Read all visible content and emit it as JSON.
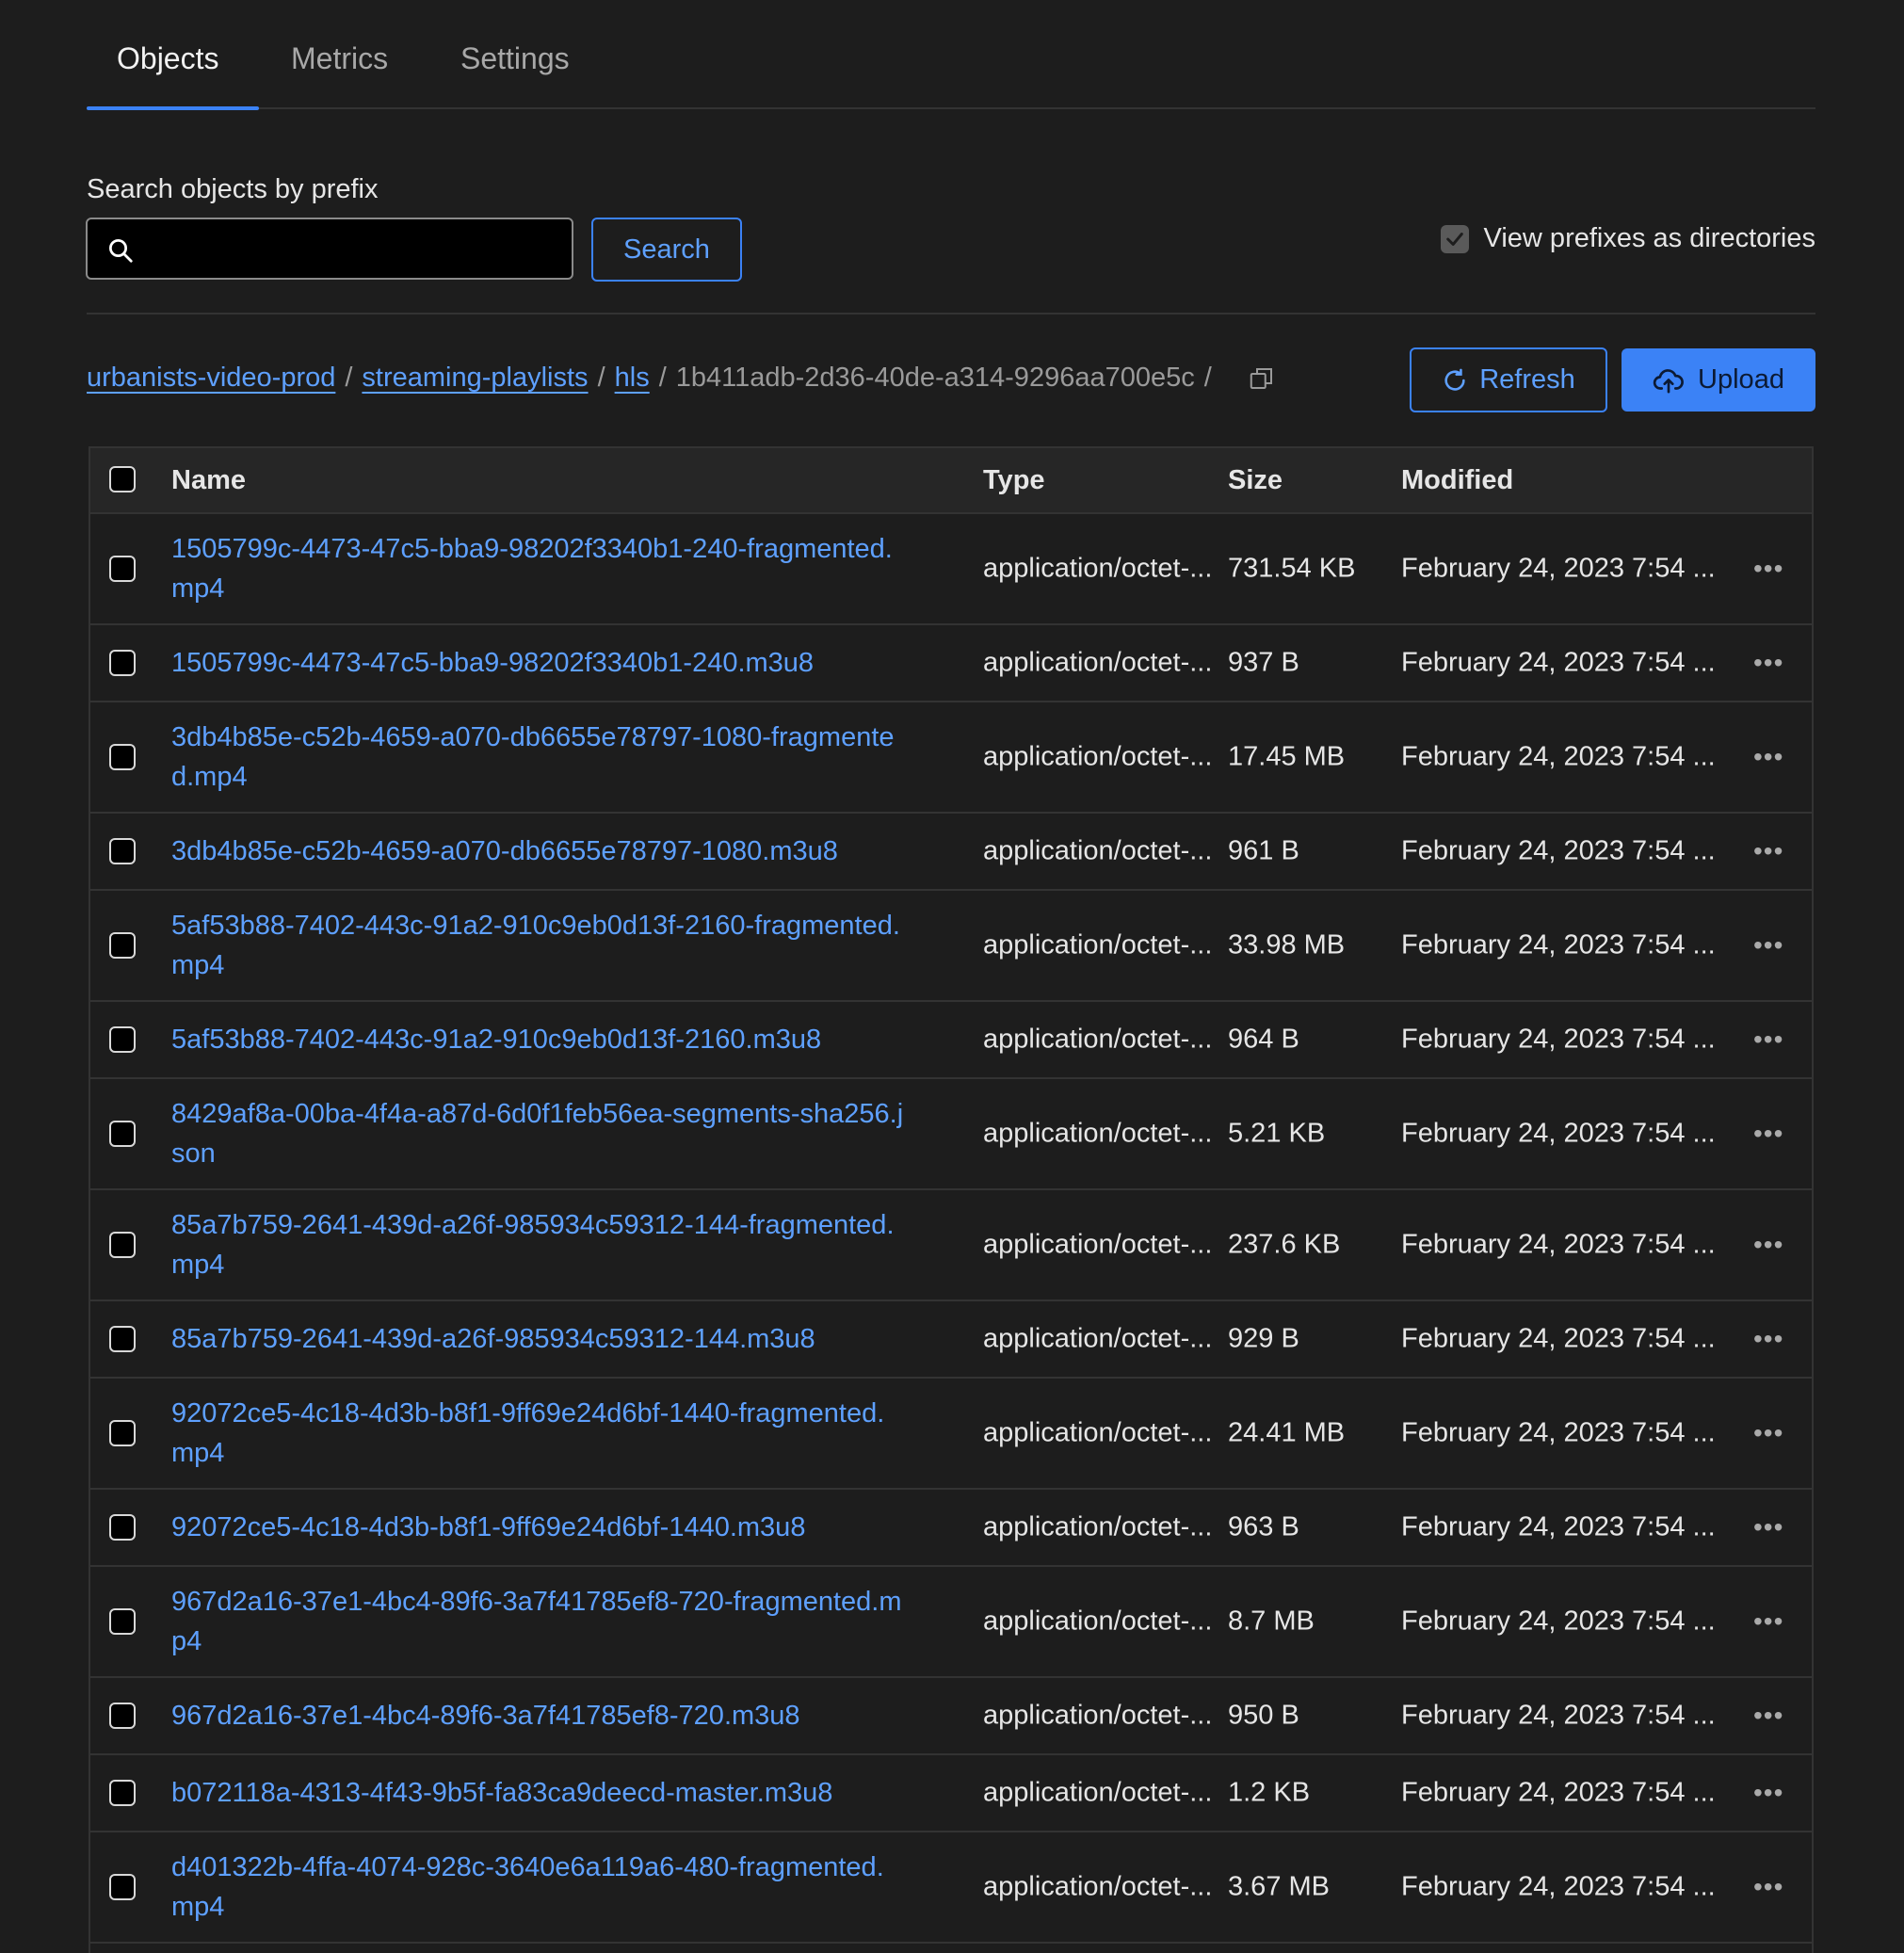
{
  "tabs": [
    {
      "label": "Objects"
    },
    {
      "label": "Metrics"
    },
    {
      "label": "Settings"
    }
  ],
  "search": {
    "label": "Search objects by prefix",
    "value": "",
    "button_label": "Search"
  },
  "prefix_toggle": {
    "label": "View prefixes as directories",
    "checked": true
  },
  "breadcrumb": {
    "bucket": "urbanists-video-prod",
    "folder1": "streaming-playlists",
    "folder2": "hls",
    "current": "1b411adb-2d36-40de-a314-9296aa700e5c",
    "separator": "/"
  },
  "actions": {
    "refresh_label": "Refresh",
    "upload_label": "Upload"
  },
  "table": {
    "headers": {
      "name": "Name",
      "type": "Type",
      "size": "Size",
      "modified": "Modified"
    },
    "rows": [
      {
        "name": "1505799c-4473-47c5-bba9-98202f3340b1-240-fragmented.mp4",
        "type": "application/octet-...",
        "size": "731.54 KB",
        "modified": "February 24, 2023 7:54 ..."
      },
      {
        "name": "1505799c-4473-47c5-bba9-98202f3340b1-240.m3u8",
        "type": "application/octet-...",
        "size": "937 B",
        "modified": "February 24, 2023 7:54 ..."
      },
      {
        "name": "3db4b85e-c52b-4659-a070-db6655e78797-1080-fragmented.mp4",
        "type": "application/octet-...",
        "size": "17.45 MB",
        "modified": "February 24, 2023 7:54 ..."
      },
      {
        "name": "3db4b85e-c52b-4659-a070-db6655e78797-1080.m3u8",
        "type": "application/octet-...",
        "size": "961 B",
        "modified": "February 24, 2023 7:54 ..."
      },
      {
        "name": "5af53b88-7402-443c-91a2-910c9eb0d13f-2160-fragmented.mp4",
        "type": "application/octet-...",
        "size": "33.98 MB",
        "modified": "February 24, 2023 7:54 ..."
      },
      {
        "name": "5af53b88-7402-443c-91a2-910c9eb0d13f-2160.m3u8",
        "type": "application/octet-...",
        "size": "964 B",
        "modified": "February 24, 2023 7:54 ..."
      },
      {
        "name": "8429af8a-00ba-4f4a-a87d-6d0f1feb56ea-segments-sha256.json",
        "type": "application/octet-...",
        "size": "5.21 KB",
        "modified": "February 24, 2023 7:54 ..."
      },
      {
        "name": "85a7b759-2641-439d-a26f-985934c59312-144-fragmented.mp4",
        "type": "application/octet-...",
        "size": "237.6 KB",
        "modified": "February 24, 2023 7:54 ..."
      },
      {
        "name": "85a7b759-2641-439d-a26f-985934c59312-144.m3u8",
        "type": "application/octet-...",
        "size": "929 B",
        "modified": "February 24, 2023 7:54 ..."
      },
      {
        "name": "92072ce5-4c18-4d3b-b8f1-9ff69e24d6bf-1440-fragmented.mp4",
        "type": "application/octet-...",
        "size": "24.41 MB",
        "modified": "February 24, 2023 7:54 ..."
      },
      {
        "name": "92072ce5-4c18-4d3b-b8f1-9ff69e24d6bf-1440.m3u8",
        "type": "application/octet-...",
        "size": "963 B",
        "modified": "February 24, 2023 7:54 ..."
      },
      {
        "name": "967d2a16-37e1-4bc4-89f6-3a7f41785ef8-720-fragmented.mp4",
        "type": "application/octet-...",
        "size": "8.7 MB",
        "modified": "February 24, 2023 7:54 ..."
      },
      {
        "name": "967d2a16-37e1-4bc4-89f6-3a7f41785ef8-720.m3u8",
        "type": "application/octet-...",
        "size": "950 B",
        "modified": "February 24, 2023 7:54 ..."
      },
      {
        "name": "b072118a-4313-4f43-9b5f-fa83ca9deecd-master.m3u8",
        "type": "application/octet-...",
        "size": "1.2 KB",
        "modified": "February 24, 2023 7:54 ..."
      },
      {
        "name": "d401322b-4ffa-4074-928c-3640e6a119a6-480-fragmented.mp4",
        "type": "application/octet-...",
        "size": "3.67 MB",
        "modified": "February 24, 2023 7:54 ..."
      }
    ]
  },
  "colors": {
    "accent": "#3b82f6",
    "link": "#5ea0ff",
    "background": "#1d1d1d"
  }
}
